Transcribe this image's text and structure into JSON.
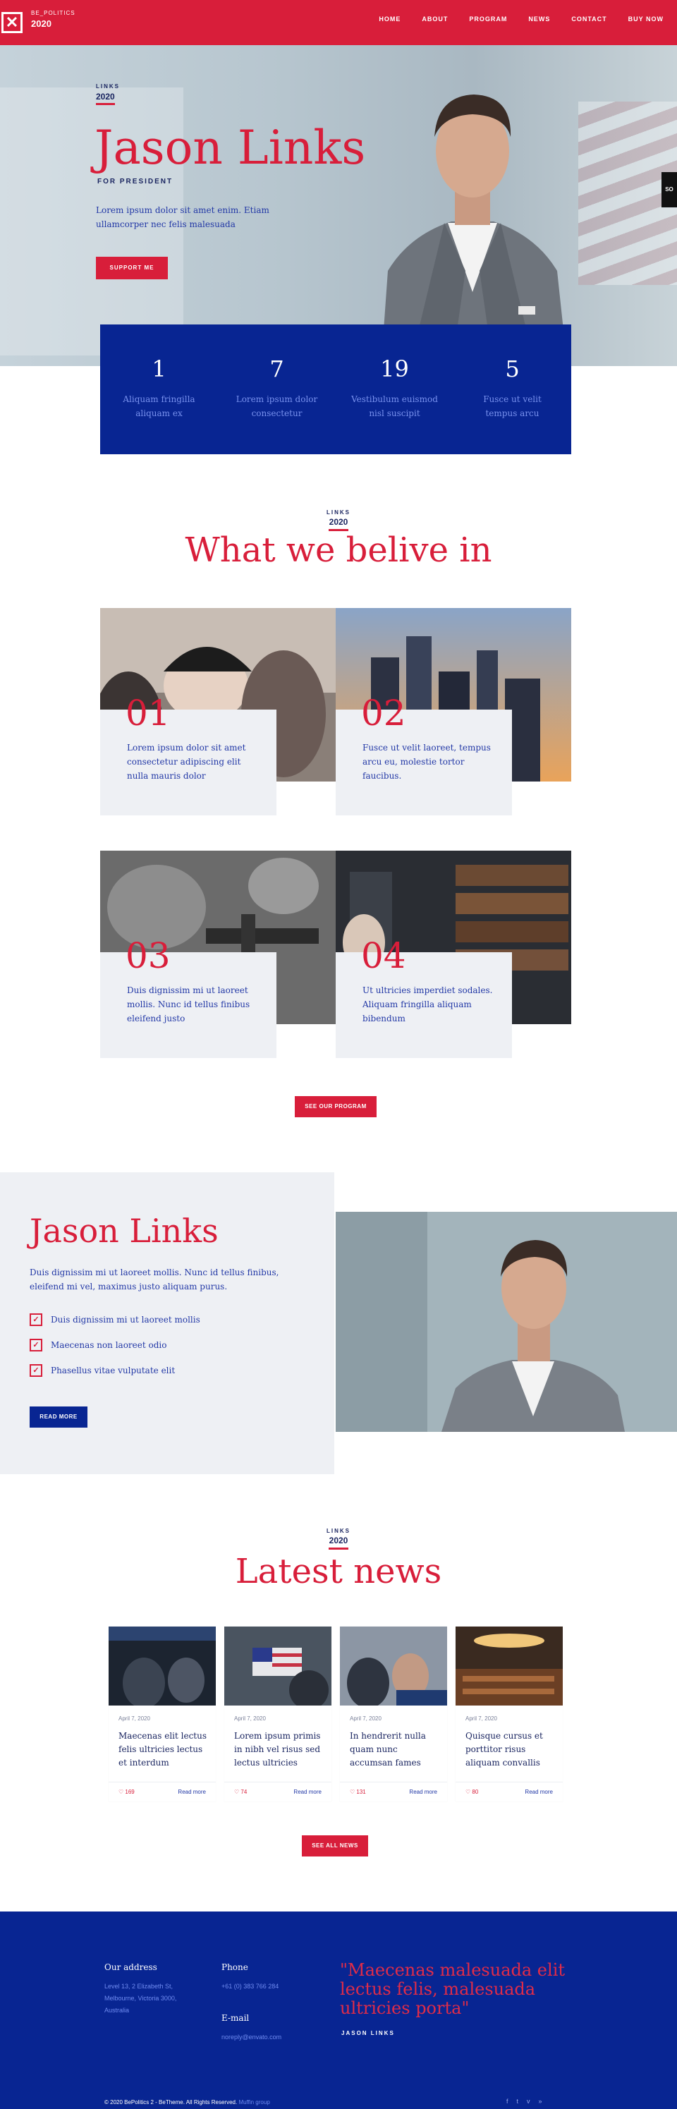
{
  "nav": {
    "logo_small": "BE_POLITICS",
    "logo_year": "2020",
    "items": [
      {
        "label": "HOME"
      },
      {
        "label": "ABOUT"
      },
      {
        "label": "PROGRAM"
      },
      {
        "label": "NEWS"
      },
      {
        "label": "CONTACT"
      },
      {
        "label": "BUY NOW"
      }
    ]
  },
  "hero": {
    "tag_small": "LINKS",
    "tag_year": "2020",
    "name": "Jason Links",
    "subtitle": "FOR PRESIDENT",
    "text": "Lorem ipsum dolor sit amet enim. Etiam ullamcorper nec felis malesuada",
    "button": "SUPPORT ME",
    "side_tab": "SO"
  },
  "stats": [
    {
      "number": "1",
      "label": "Aliquam fringilla aliquam ex"
    },
    {
      "number": "7",
      "label": "Lorem ipsum dolor consectetur"
    },
    {
      "number": "19",
      "label": "Vestibulum euismod nisl suscipit"
    },
    {
      "number": "5",
      "label": "Fusce ut velit tempus arcu"
    }
  ],
  "beliefs": {
    "tag_small": "LINKS",
    "tag_year": "2020",
    "title": "What we belive in",
    "items": [
      {
        "num": "01",
        "text": "Lorem ipsum dolor sit amet consectetur adipiscing elit nulla mauris dolor"
      },
      {
        "num": "02",
        "text": "Fusce ut velit laoreet, tempus arcu eu, molestie tortor faucibus."
      },
      {
        "num": "03",
        "text": "Duis dignissim mi ut laoreet mollis. Nunc id tellus finibus eleifend justo"
      },
      {
        "num": "04",
        "text": "Ut ultricies imperdiet sodales. Aliquam fringilla aliquam bibendum"
      }
    ],
    "button": "SEE OUR PROGRAM"
  },
  "about": {
    "name": "Jason Links",
    "text": "Duis dignissim mi ut laoreet mollis. Nunc id tellus finibus, eleifend mi vel, maximus justo aliquam purus.",
    "checks": [
      {
        "label": "Duis dignissim mi ut laoreet mollis"
      },
      {
        "label": "Maecenas non laoreet odio"
      },
      {
        "label": "Phasellus vitae vulputate elit"
      }
    ],
    "button": "READ MORE"
  },
  "news": {
    "tag_small": "LINKS",
    "tag_year": "2020",
    "title": "Latest news",
    "items": [
      {
        "date": "April 7, 2020",
        "title": "Maecenas elit lectus felis ultricies lectus et interdum",
        "likes": "169",
        "read": "Read more"
      },
      {
        "date": "April 7, 2020",
        "title": "Lorem ipsum primis in nibh vel risus sed lectus ultricies",
        "likes": "74",
        "read": "Read more"
      },
      {
        "date": "April 7, 2020",
        "title": "In hendrerit nulla quam nunc accumsan fames",
        "likes": "131",
        "read": "Read more"
      },
      {
        "date": "April 7, 2020",
        "title": "Quisque cursus et porttitor risus aliquam convallis",
        "likes": "80",
        "read": "Read more"
      }
    ],
    "button": "SEE ALL NEWS"
  },
  "footer": {
    "address_head": "Our address",
    "address_lines": [
      "Level 13, 2 Elizabeth St,",
      "Melbourne, Victoria 3000,",
      "Australia"
    ],
    "phone_head": "Phone",
    "phone": "+61 (0) 383 766 284",
    "email_head": "E-mail",
    "email": "noreply@envato.com",
    "quote": "\"Maecenas malesuada elit lectus felis, malesuada ultricies porta\"",
    "author": "JASON LINKS",
    "copyright": "© 2020 BePolitics 2 - BeTheme. All Rights Reserved.",
    "copyright_link": "Muffin group",
    "social": [
      "f",
      "t",
      "v",
      "»"
    ]
  },
  "colors": {
    "red": "#d81e3a",
    "navy": "#082592",
    "light_gray": "#eef0f4"
  }
}
